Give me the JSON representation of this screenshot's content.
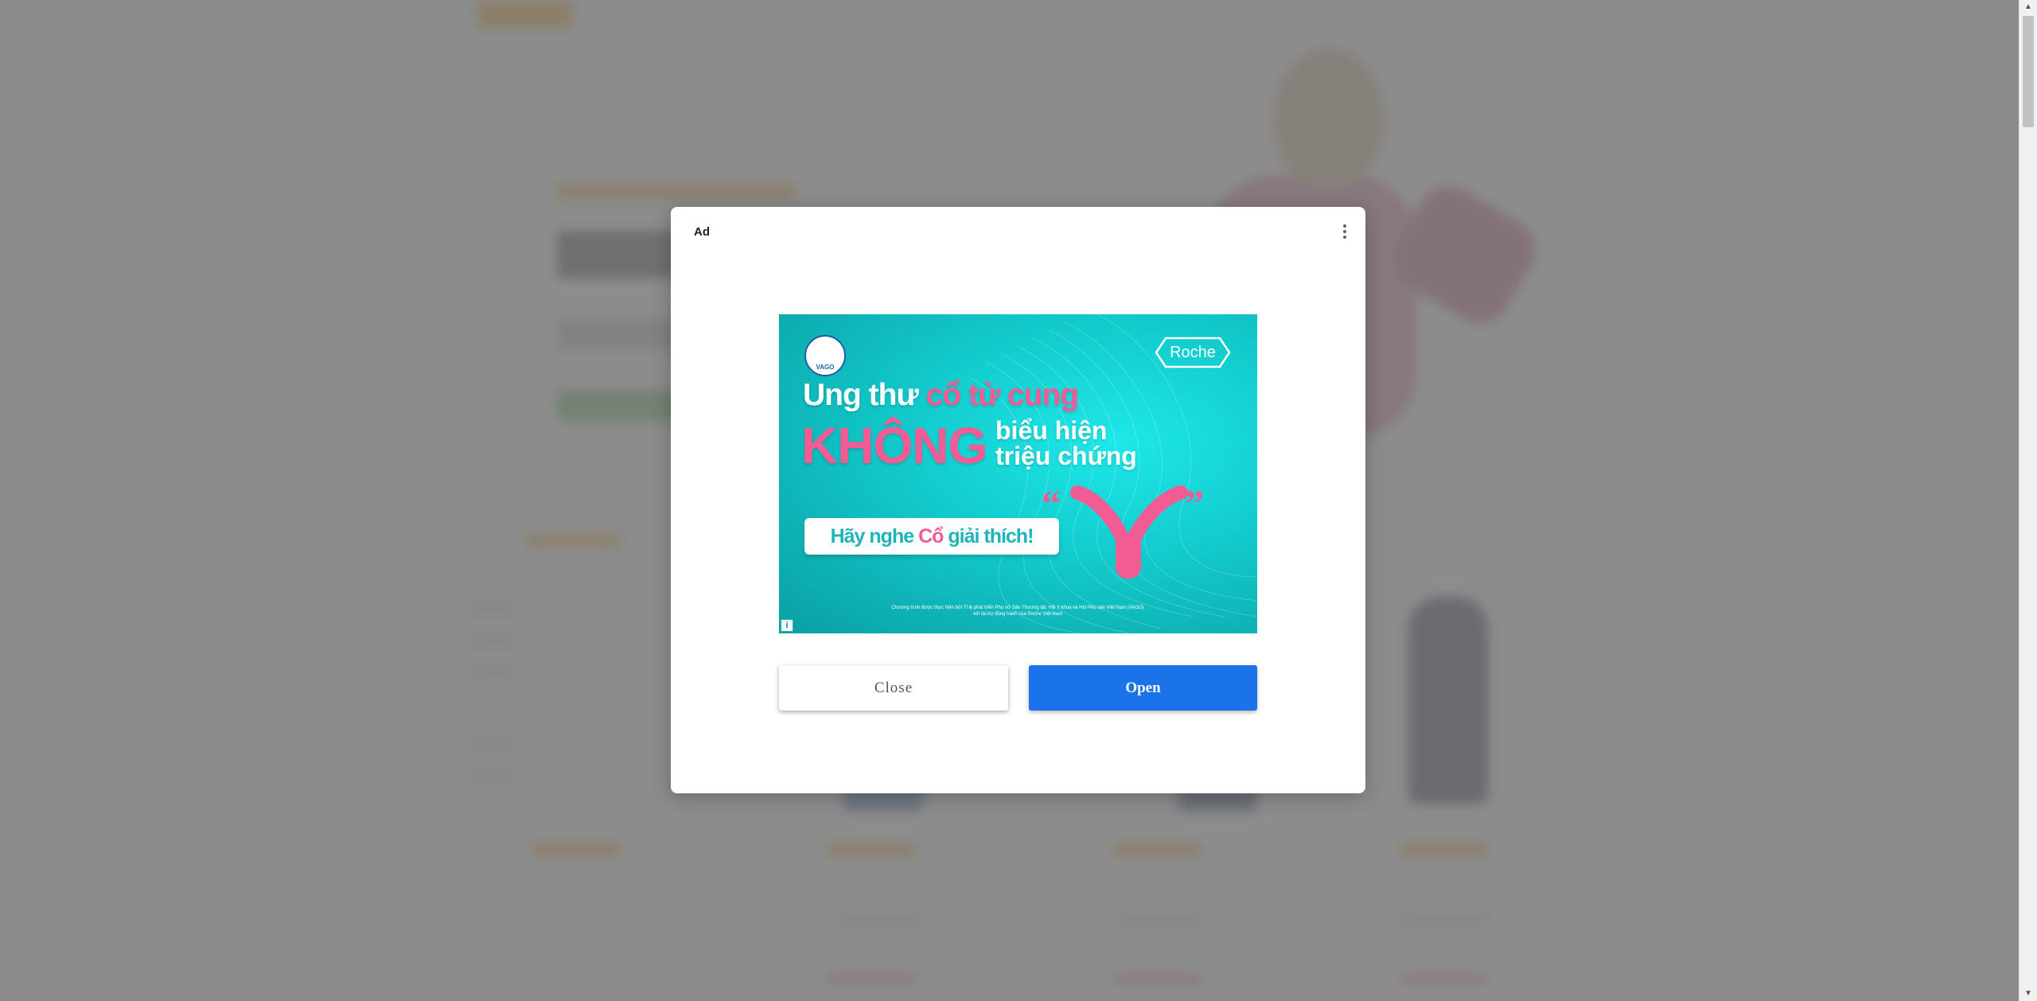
{
  "ad": {
    "label": "Ad",
    "creative": {
      "logo_left_text": "VAGO",
      "logo_right_text": "Roche",
      "headline_part1": "Ung thư ",
      "headline_part2": "cổ tử cung",
      "headline_emphasis": "KHÔNG",
      "headline_line2a": "biểu hiện",
      "headline_line2b": "triệu chứng",
      "cta_part1": "Hãy nghe ",
      "cta_part2": "Cổ",
      "cta_part3": " giải thích!",
      "fine_print": "Chương trình được thực hiện bởi Tỉ lệ phát triển Phụ nữ Sản Thương tật, Hội Y khoa và Hội Phụ sản Việt Nam (VAGO) với tài trợ đồng hành của Roche Việt Nam",
      "adchoices_symbol": "i"
    },
    "close_label": "Close",
    "open_label": "Open",
    "colors": {
      "open_button": "#1a73e8",
      "creative_teal": "#12c9cb",
      "creative_pink": "#f25b93"
    }
  },
  "icons": {
    "menu": "vertical-dots-icon",
    "adchoices": "info-icon"
  }
}
